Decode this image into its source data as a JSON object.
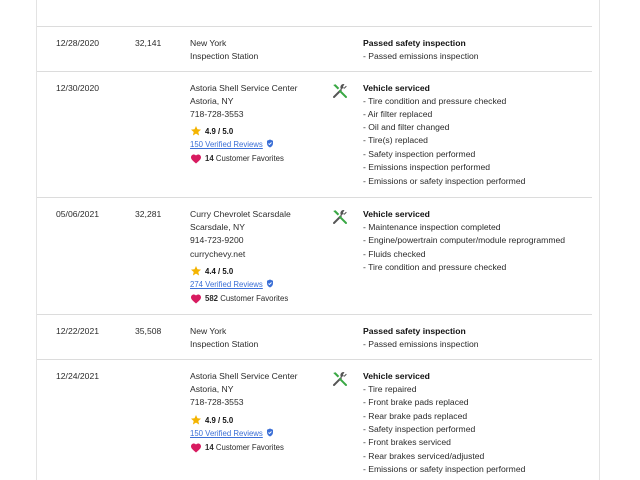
{
  "records": [
    {
      "date": "12/28/2020",
      "mileage": "32,141",
      "shop": {
        "name": "New York",
        "lines": [
          "Inspection Station"
        ]
      },
      "summary": "Passed safety inspection",
      "items": [
        "- Passed emissions inspection"
      ],
      "has_icon": false
    },
    {
      "date": "12/30/2020",
      "mileage": "",
      "shop": {
        "name": "Astoria Shell Service Center",
        "lines": [
          "Astoria, NY",
          "718-728-3553"
        ]
      },
      "rating": "4.9 / 5.0",
      "reviews": "150 Verified Reviews",
      "favorites_count": "14",
      "favorites_label": "Customer Favorites",
      "summary": "Vehicle serviced",
      "items": [
        "- Tire condition and pressure checked",
        "- Air filter replaced",
        "- Oil and filter changed",
        "- Tire(s) replaced",
        "- Safety inspection performed",
        "- Emissions inspection performed",
        "- Emissions or safety inspection performed"
      ],
      "icon": "tools-icon"
    },
    {
      "date": "05/06/2021",
      "mileage": "32,281",
      "shop": {
        "name": "Curry Chevrolet Scarsdale",
        "lines": [
          "Scarsdale, NY",
          "914-723-9200",
          "currychevy.net"
        ]
      },
      "rating": "4.4 / 5.0",
      "reviews": "274 Verified Reviews",
      "favorites_count": "582",
      "favorites_label": "Customer Favorites",
      "summary": "Vehicle serviced",
      "items": [
        "- Maintenance inspection completed",
        "- Engine/powertrain computer/module reprogrammed",
        "- Fluids checked",
        "- Tire condition and pressure checked"
      ],
      "icon": "tools-icon"
    },
    {
      "date": "12/22/2021",
      "mileage": "35,508",
      "shop": {
        "name": "New York",
        "lines": [
          "Inspection Station"
        ]
      },
      "summary": "Passed safety inspection",
      "items": [
        "- Passed emissions inspection"
      ],
      "has_icon": false
    },
    {
      "date": "12/24/2021",
      "mileage": "",
      "shop": {
        "name": "Astoria Shell Service Center",
        "lines": [
          "Astoria, NY",
          "718-728-3553"
        ]
      },
      "rating": "4.9 / 5.0",
      "reviews": "150 Verified Reviews",
      "favorites_count": "14",
      "favorites_label": "Customer Favorites",
      "summary": "Vehicle serviced",
      "items": [
        "- Tire repaired",
        "- Front brake pads replaced",
        "- Rear brake pads replaced",
        "- Safety inspection performed",
        "- Front brakes serviced",
        "- Rear brakes serviced/adjusted",
        "- Emissions or safety inspection performed"
      ],
      "icon": "tools-icon"
    }
  ],
  "colors": {
    "star": "#f4b400",
    "heart": "#d81b60",
    "link": "#3b6fd6",
    "verified": "#3b6fd6",
    "divider": "#dcdcdc"
  }
}
